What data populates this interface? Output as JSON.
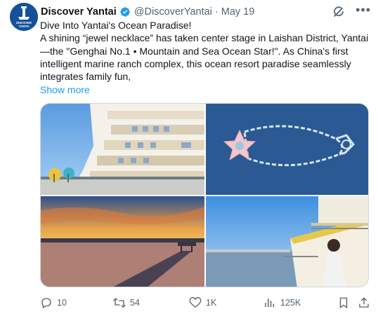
{
  "account": {
    "avatar_text": "DISCOVER YANTAI",
    "display_name": "Discover Yantai",
    "handle": "@DiscoverYantai",
    "separator": "·",
    "date": "May 19"
  },
  "post": {
    "line1": "Dive Into Yantai's Ocean Paradise!",
    "body": "A shining “jewel necklace” has taken center stage in Laishan District, Yantai—the \"Genghai No.1 • Mountain and Sea Ocean Star!\". As China's first intelligent marine ranch complex, this ocean resort paradise seamlessly integrates family fun,",
    "show_more": "Show more"
  },
  "media": [
    {
      "name": "cruise-ship-deck-photo"
    },
    {
      "name": "star-shaped-ocean-ranch-photo"
    },
    {
      "name": "sunset-pier-photo"
    },
    {
      "name": "woman-on-ship-deck-photo"
    }
  ],
  "actions": {
    "replies": "10",
    "reposts": "54",
    "likes": "1K",
    "views": "125K"
  },
  "colors": {
    "link": "#1d9bf0",
    "muted": "#536471",
    "verified": "#1d9bf0",
    "avatar_bg": "#15519a"
  }
}
